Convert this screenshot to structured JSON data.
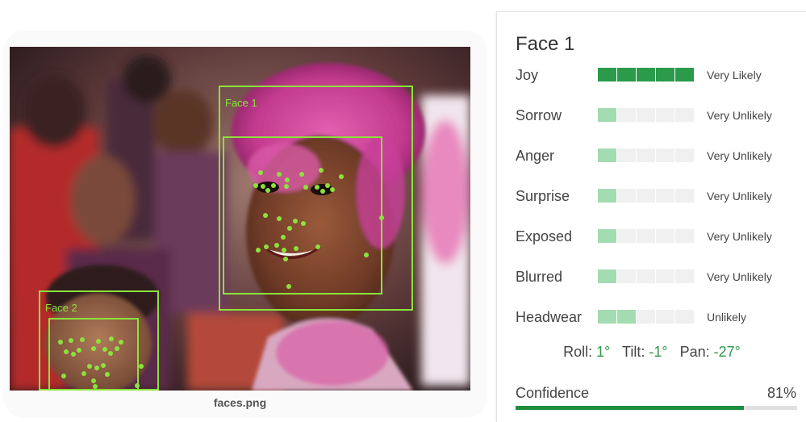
{
  "image": {
    "filename": "faces.png"
  },
  "faces": [
    {
      "tag": "Face 1"
    },
    {
      "tag": "Face 2"
    }
  ],
  "details": {
    "title": "Face 1",
    "attributes": [
      {
        "name": "Joy",
        "value": "Very Likely",
        "level": 5
      },
      {
        "name": "Sorrow",
        "value": "Very Unlikely",
        "level": 1
      },
      {
        "name": "Anger",
        "value": "Very Unlikely",
        "level": 1
      },
      {
        "name": "Surprise",
        "value": "Very Unlikely",
        "level": 1
      },
      {
        "name": "Exposed",
        "value": "Very Unlikely",
        "level": 1
      },
      {
        "name": "Blurred",
        "value": "Very Unlikely",
        "level": 1
      },
      {
        "name": "Headwear",
        "value": "Unlikely",
        "level": 2
      }
    ],
    "angles": {
      "roll_label": "Roll:",
      "roll_value": "1°",
      "tilt_label": "Tilt:",
      "tilt_value": "-1°",
      "pan_label": "Pan:",
      "pan_value": "-27°"
    },
    "confidence": {
      "label": "Confidence",
      "value": "81%",
      "fraction": 0.81
    }
  },
  "colors": {
    "box": "#8be23c",
    "bar_strong": "#2b9a4a",
    "bar_weak": "#a3dcb0",
    "accent": "#1e8e3e"
  }
}
